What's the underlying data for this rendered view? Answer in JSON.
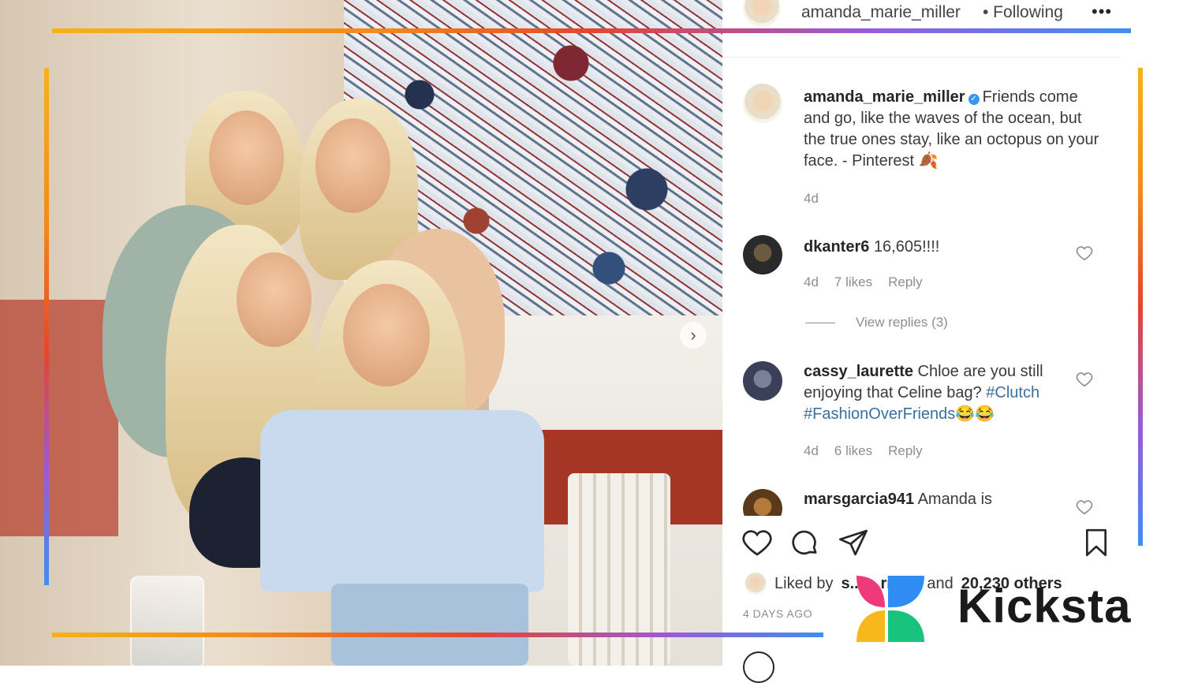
{
  "post": {
    "author": "amanda_marie_miller",
    "following_label": "• Following",
    "more_label": "•••",
    "caption": "Friends come and go, like the waves of the ocean, but the true ones stay, like an octopus on your face. - Pinterest 🍂",
    "caption_age": "4d"
  },
  "comments": [
    {
      "user": "dkanter6",
      "text": "16,605!!!!",
      "age": "4d",
      "likes": "7 likes",
      "reply": "Reply",
      "view_replies": "View replies (3)"
    },
    {
      "user": "cassy_laurette",
      "text": "Chloe are you still enjoying that Celine bag? ",
      "hashtags": "#Clutch #FashionOverFriends",
      "emoji": "😂😂",
      "age": "4d",
      "likes": "6 likes",
      "reply": "Reply"
    },
    {
      "user": "marsgarcia941",
      "text": "Amanda is"
    }
  ],
  "likes": {
    "prefix": "Liked by",
    "user": "s... ...rigan",
    "middle": "and",
    "others": "20,230 others"
  },
  "time_ago": "4 DAYS AGO",
  "brand": {
    "name": "Kicksta"
  },
  "colors": {
    "frame_gradient": [
      "#f5b21a",
      "#f28b1c",
      "#e3462e",
      "#9a5ad8",
      "#3f8ff0"
    ],
    "verified": "#3897f0",
    "hashtag": "#3b6fa0",
    "logo_pink": "#ef3a7a",
    "logo_blue": "#2f8cf3",
    "logo_yellow": "#f6b81a",
    "logo_green": "#19c37d"
  },
  "icons": [
    "chevron-right-icon",
    "more-icon",
    "verified-icon",
    "heart-icon",
    "comment-icon",
    "share-icon",
    "bookmark-icon"
  ]
}
